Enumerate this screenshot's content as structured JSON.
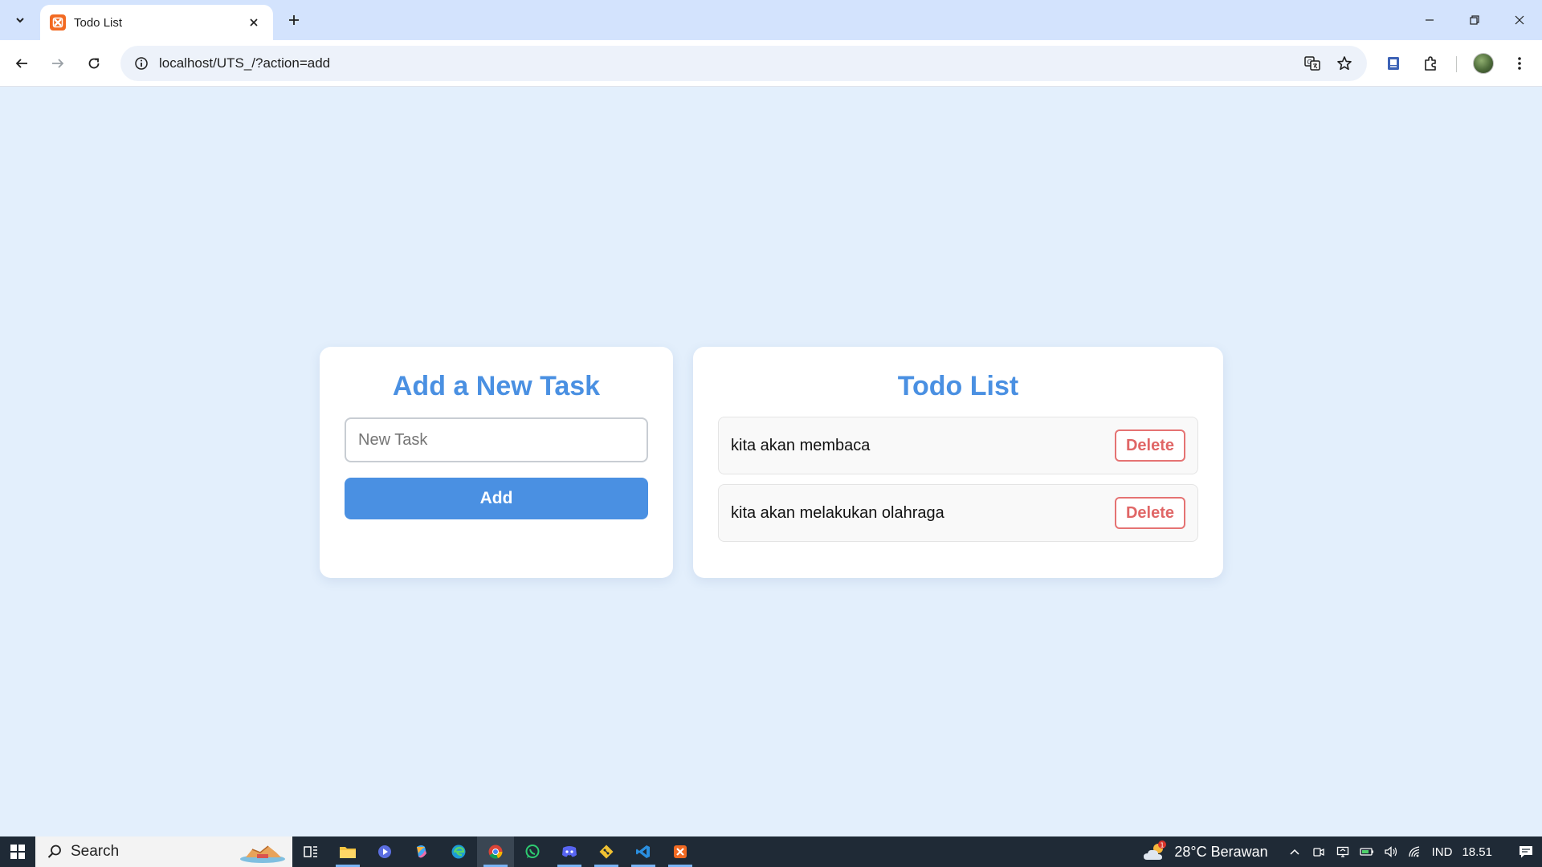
{
  "browser": {
    "tab_title": "Todo List",
    "url": "localhost/UTS_/?action=add"
  },
  "add_card": {
    "title": "Add a New Task",
    "input_placeholder": "New Task",
    "input_value": "",
    "add_label": "Add"
  },
  "list_card": {
    "title": "Todo List",
    "items": [
      {
        "text": "kita akan membaca",
        "delete_label": "Delete"
      },
      {
        "text": "kita akan melakukan olahraga",
        "delete_label": "Delete"
      }
    ]
  },
  "taskbar": {
    "search_label": "Search",
    "weather": "28°C Berawan",
    "weather_badge": "1",
    "language": "IND",
    "time": "18.51"
  },
  "colors": {
    "page_bg": "#e3effc",
    "accent": "#4a90e2",
    "delete": "#e06666",
    "tab_favicon": "#f26a22"
  },
  "icons": {
    "tab_favicon": "xampp-icon",
    "taskbar_apps": [
      "task-view-icon",
      "file-explorer-icon",
      "media-player-icon",
      "copilot-icon",
      "edge-icon",
      "chrome-icon",
      "whatsapp-icon",
      "discord-icon",
      "git-icon",
      "vscode-icon",
      "xampp-icon"
    ]
  }
}
